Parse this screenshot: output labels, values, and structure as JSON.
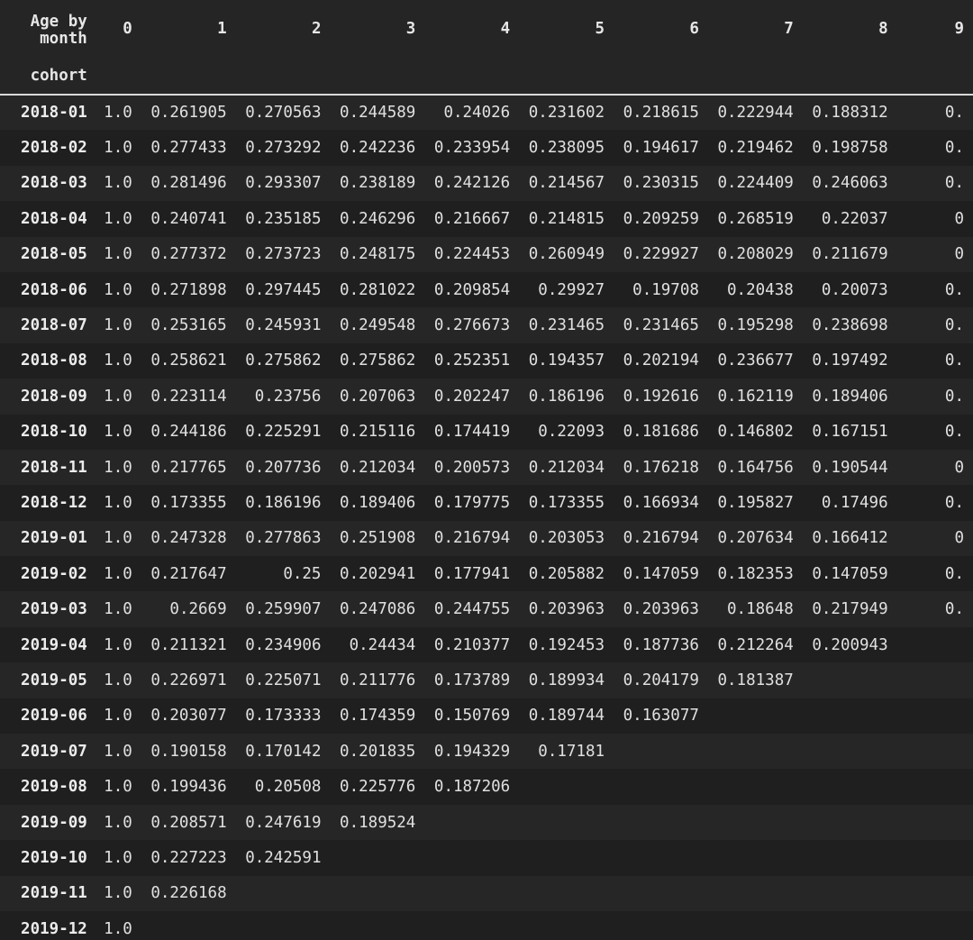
{
  "table": {
    "columns_name": "Age by month",
    "index_name": "cohort",
    "columns": [
      "0",
      "1",
      "2",
      "3",
      "4",
      "5",
      "6",
      "7",
      "8",
      "9"
    ],
    "rows": [
      {
        "cohort": "2018-01",
        "values": [
          "1.0",
          "0.261905",
          "0.270563",
          "0.244589",
          "0.24026",
          "0.231602",
          "0.218615",
          "0.222944",
          "0.188312",
          "0."
        ]
      },
      {
        "cohort": "2018-02",
        "values": [
          "1.0",
          "0.277433",
          "0.273292",
          "0.242236",
          "0.233954",
          "0.238095",
          "0.194617",
          "0.219462",
          "0.198758",
          "0."
        ]
      },
      {
        "cohort": "2018-03",
        "values": [
          "1.0",
          "0.281496",
          "0.293307",
          "0.238189",
          "0.242126",
          "0.214567",
          "0.230315",
          "0.224409",
          "0.246063",
          "0."
        ]
      },
      {
        "cohort": "2018-04",
        "values": [
          "1.0",
          "0.240741",
          "0.235185",
          "0.246296",
          "0.216667",
          "0.214815",
          "0.209259",
          "0.268519",
          "0.22037",
          "0"
        ]
      },
      {
        "cohort": "2018-05",
        "values": [
          "1.0",
          "0.277372",
          "0.273723",
          "0.248175",
          "0.224453",
          "0.260949",
          "0.229927",
          "0.208029",
          "0.211679",
          "0"
        ]
      },
      {
        "cohort": "2018-06",
        "values": [
          "1.0",
          "0.271898",
          "0.297445",
          "0.281022",
          "0.209854",
          "0.29927",
          "0.19708",
          "0.20438",
          "0.20073",
          "0."
        ]
      },
      {
        "cohort": "2018-07",
        "values": [
          "1.0",
          "0.253165",
          "0.245931",
          "0.249548",
          "0.276673",
          "0.231465",
          "0.231465",
          "0.195298",
          "0.238698",
          "0."
        ]
      },
      {
        "cohort": "2018-08",
        "values": [
          "1.0",
          "0.258621",
          "0.275862",
          "0.275862",
          "0.252351",
          "0.194357",
          "0.202194",
          "0.236677",
          "0.197492",
          "0."
        ]
      },
      {
        "cohort": "2018-09",
        "values": [
          "1.0",
          "0.223114",
          "0.23756",
          "0.207063",
          "0.202247",
          "0.186196",
          "0.192616",
          "0.162119",
          "0.189406",
          "0."
        ]
      },
      {
        "cohort": "2018-10",
        "values": [
          "1.0",
          "0.244186",
          "0.225291",
          "0.215116",
          "0.174419",
          "0.22093",
          "0.181686",
          "0.146802",
          "0.167151",
          "0."
        ]
      },
      {
        "cohort": "2018-11",
        "values": [
          "1.0",
          "0.217765",
          "0.207736",
          "0.212034",
          "0.200573",
          "0.212034",
          "0.176218",
          "0.164756",
          "0.190544",
          "0"
        ]
      },
      {
        "cohort": "2018-12",
        "values": [
          "1.0",
          "0.173355",
          "0.186196",
          "0.189406",
          "0.179775",
          "0.173355",
          "0.166934",
          "0.195827",
          "0.17496",
          "0."
        ]
      },
      {
        "cohort": "2019-01",
        "values": [
          "1.0",
          "0.247328",
          "0.277863",
          "0.251908",
          "0.216794",
          "0.203053",
          "0.216794",
          "0.207634",
          "0.166412",
          "0"
        ]
      },
      {
        "cohort": "2019-02",
        "values": [
          "1.0",
          "0.217647",
          "0.25",
          "0.202941",
          "0.177941",
          "0.205882",
          "0.147059",
          "0.182353",
          "0.147059",
          "0."
        ]
      },
      {
        "cohort": "2019-03",
        "values": [
          "1.0",
          "0.2669",
          "0.259907",
          "0.247086",
          "0.244755",
          "0.203963",
          "0.203963",
          "0.18648",
          "0.217949",
          "0."
        ]
      },
      {
        "cohort": "2019-04",
        "values": [
          "1.0",
          "0.211321",
          "0.234906",
          "0.24434",
          "0.210377",
          "0.192453",
          "0.187736",
          "0.212264",
          "0.200943",
          ""
        ]
      },
      {
        "cohort": "2019-05",
        "values": [
          "1.0",
          "0.226971",
          "0.225071",
          "0.211776",
          "0.173789",
          "0.189934",
          "0.204179",
          "0.181387",
          "",
          ""
        ]
      },
      {
        "cohort": "2019-06",
        "values": [
          "1.0",
          "0.203077",
          "0.173333",
          "0.174359",
          "0.150769",
          "0.189744",
          "0.163077",
          "",
          "",
          ""
        ]
      },
      {
        "cohort": "2019-07",
        "values": [
          "1.0",
          "0.190158",
          "0.170142",
          "0.201835",
          "0.194329",
          "0.17181",
          "",
          "",
          "",
          ""
        ]
      },
      {
        "cohort": "2019-08",
        "values": [
          "1.0",
          "0.199436",
          "0.20508",
          "0.225776",
          "0.187206",
          "",
          "",
          "",
          "",
          ""
        ]
      },
      {
        "cohort": "2019-09",
        "values": [
          "1.0",
          "0.208571",
          "0.247619",
          "0.189524",
          "",
          "",
          "",
          "",
          "",
          ""
        ]
      },
      {
        "cohort": "2019-10",
        "values": [
          "1.0",
          "0.227223",
          "0.242591",
          "",
          "",
          "",
          "",
          "",
          "",
          ""
        ]
      },
      {
        "cohort": "2019-11",
        "values": [
          "1.0",
          "0.226168",
          "",
          "",
          "",
          "",
          "",
          "",
          "",
          ""
        ]
      },
      {
        "cohort": "2019-12",
        "values": [
          "1.0",
          "",
          "",
          "",
          "",
          "",
          "",
          "",
          "",
          ""
        ]
      }
    ]
  }
}
